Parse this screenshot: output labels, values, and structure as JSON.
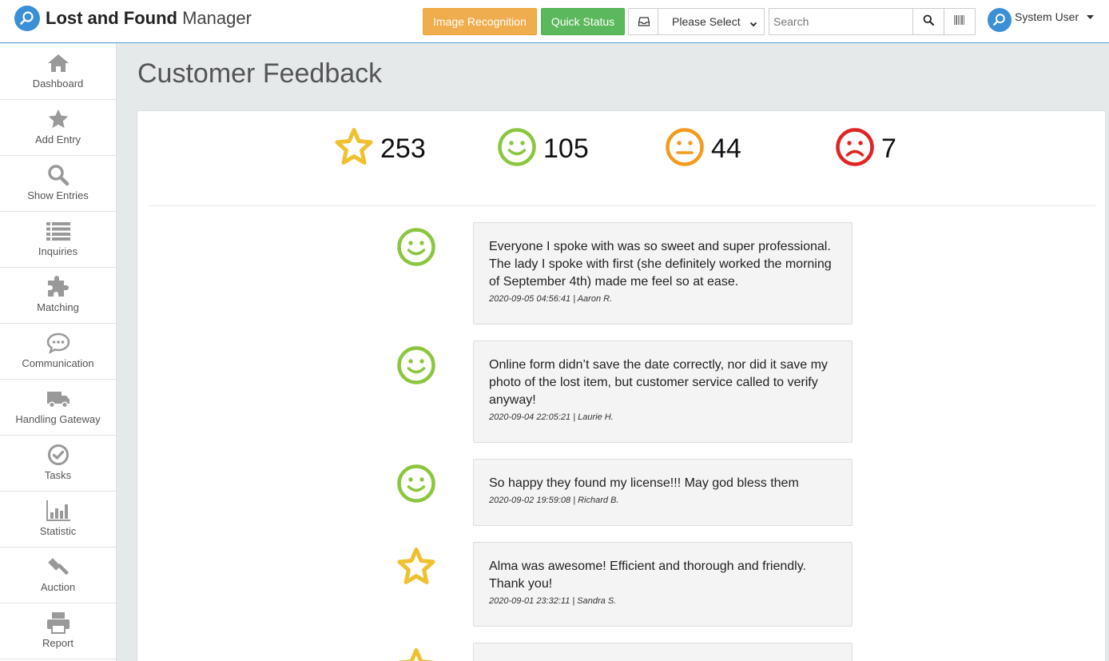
{
  "app": {
    "brand_bold": "Lost and Found",
    "brand_light": "Manager"
  },
  "toolbar": {
    "image_recognition_label": "Image Recognition",
    "quick_status_label": "Quick Status",
    "select_value": "Please Select",
    "search_placeholder": "Search",
    "user_name": "System User"
  },
  "colors": {
    "accent": "#3a8fd6",
    "orange": "#f0ad4e",
    "green": "#5cb85c",
    "star": "#f0c030",
    "happy": "#8cc63f",
    "neutral": "#f29b1d",
    "sad": "#e02424"
  },
  "sidebar": {
    "items": [
      {
        "label": "Dashboard",
        "icon": "home-icon"
      },
      {
        "label": "Add Entry",
        "icon": "star-icon"
      },
      {
        "label": "Show Entries",
        "icon": "search-icon"
      },
      {
        "label": "Inquiries",
        "icon": "list-icon"
      },
      {
        "label": "Matching",
        "icon": "puzzle-icon"
      },
      {
        "label": "Communication",
        "icon": "chat-icon"
      },
      {
        "label": "Handling Gateway",
        "icon": "truck-icon"
      },
      {
        "label": "Tasks",
        "icon": "check-circle-icon"
      },
      {
        "label": "Statistic",
        "icon": "bar-chart-icon"
      },
      {
        "label": "Auction",
        "icon": "gavel-icon"
      },
      {
        "label": "Report",
        "icon": "print-icon"
      }
    ]
  },
  "main": {
    "title": "Customer Feedback",
    "stats": {
      "star": "253",
      "happy": "105",
      "neutral": "44",
      "sad": "7"
    },
    "feedback": [
      {
        "rating": "happy",
        "text": "Everyone I spoke with was so sweet and super professional. The lady I spoke with first (she definitely worked the morning of September 4th) made me feel so at ease.",
        "meta": "2020-09-05 04:56:41 | Aaron R."
      },
      {
        "rating": "happy",
        "text": "Online form didn’t save the date correctly, nor did it save my photo of the lost item, but customer service called to verify anyway!",
        "meta": "2020-09-04 22:05:21 | Laurie H."
      },
      {
        "rating": "happy",
        "text": "So happy they found my license!!! May god bless them",
        "meta": "2020-09-02 19:59:08 | Richard B."
      },
      {
        "rating": "star",
        "text": "Alma was awesome! Efficient and thorough and friendly. Thank you!",
        "meta": "2020-09-01 23:32:11 | Sandra S."
      },
      {
        "rating": "star",
        "text": "",
        "meta": ""
      }
    ]
  }
}
